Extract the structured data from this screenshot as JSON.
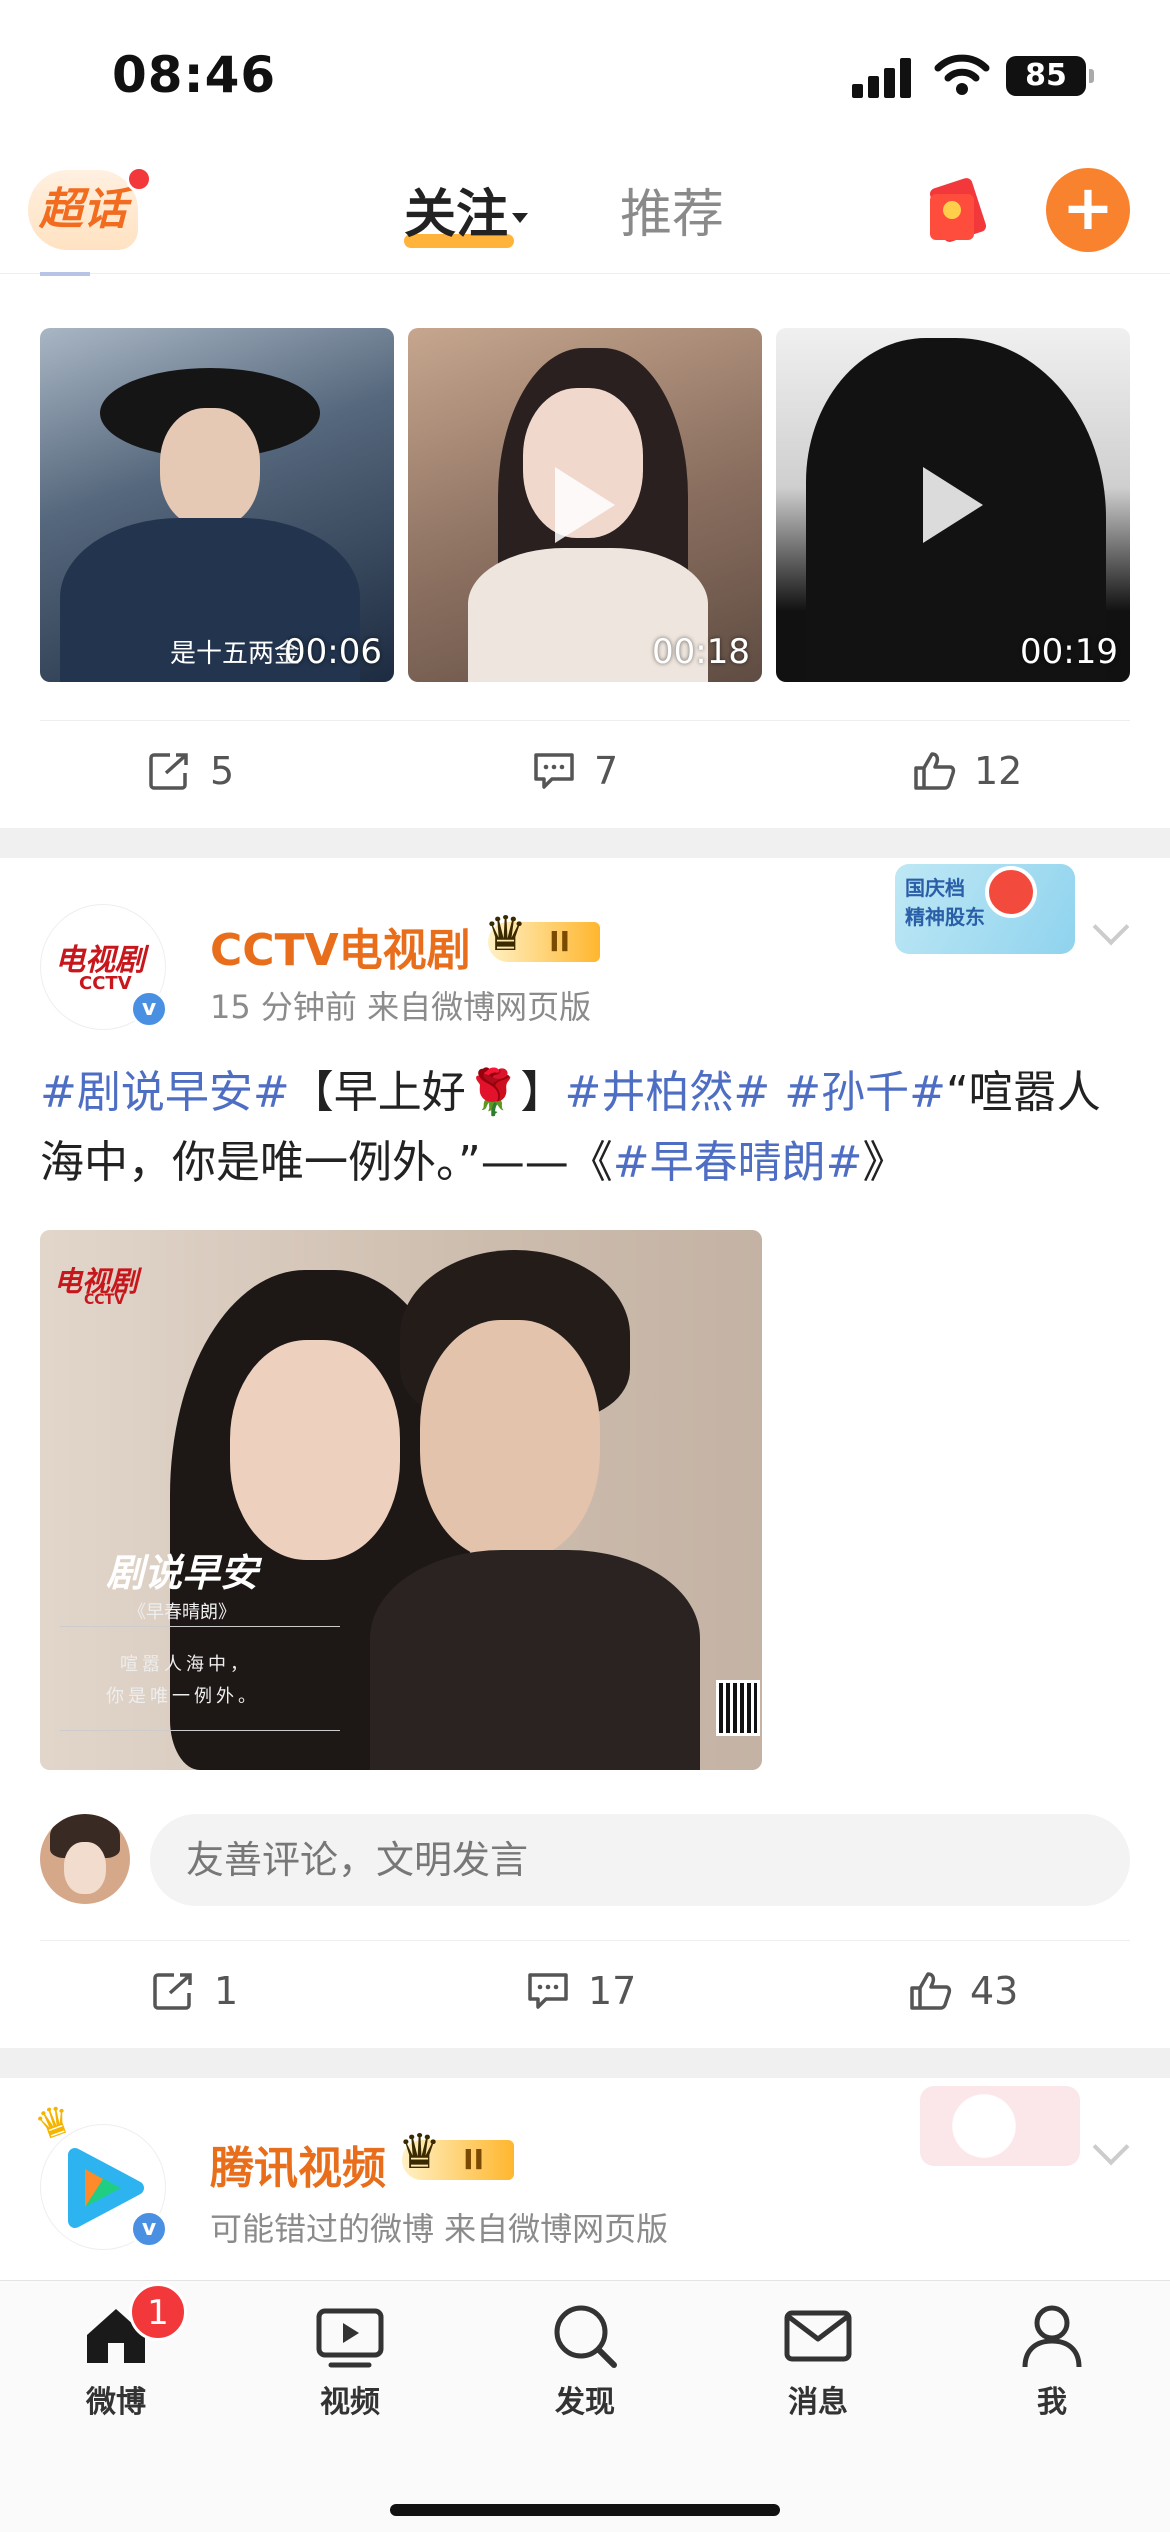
{
  "status": {
    "time": "08:46",
    "battery": "85"
  },
  "topnav": {
    "chaohua_label": "超话",
    "tab_follow": "关注",
    "tab_recommend": "推荐",
    "plus": "+"
  },
  "videos": [
    {
      "duration": "00:06",
      "caption": "是十五两金"
    },
    {
      "duration": "00:18",
      "caption": ""
    },
    {
      "duration": "00:19",
      "caption": ""
    }
  ],
  "post0_actions": {
    "share": "5",
    "comment": "7",
    "like": "12"
  },
  "post1": {
    "username": "CCTV电视剧",
    "avatar_label": "电视剧",
    "avatar_sub": "CCTV",
    "vip_level": "II",
    "meta": "15 分钟前  来自微博网页版",
    "verified": "v",
    "text_parts": [
      {
        "text": "#剧说早安#",
        "tag": true
      },
      {
        "text": "【早上好🌹】",
        "tag": false
      },
      {
        "text": "#井柏然#",
        "tag": true
      },
      {
        "text": " ",
        "tag": false
      },
      {
        "text": "#孙千#",
        "tag": true
      },
      {
        "text": "“喧嚣人海中，你是唯一例外。”——《",
        "tag": false
      },
      {
        "text": "#早春晴朗#",
        "tag": true
      },
      {
        "text": "》",
        "tag": false
      }
    ],
    "image": {
      "logo": "电视剧",
      "logo_sub": "CCTV",
      "title": "剧说早安",
      "subtitle": "《早春晴朗》",
      "line1": "喧嚣人海中，",
      "line2": "你是唯一例外。"
    },
    "deco_text": "国庆档\n精神股东",
    "comment_placeholder": "友善评论，文明发言",
    "actions": {
      "share": "1",
      "comment": "17",
      "like": "43"
    }
  },
  "post2": {
    "username": "腾讯视频",
    "vip_level": "II",
    "meta": "可能错过的微博  来自微博网页版",
    "verified": "v"
  },
  "tabbar": {
    "items": [
      {
        "label": "微博",
        "badge": "1"
      },
      {
        "label": "视频"
      },
      {
        "label": "发现"
      },
      {
        "label": "消息"
      },
      {
        "label": "我"
      }
    ]
  }
}
